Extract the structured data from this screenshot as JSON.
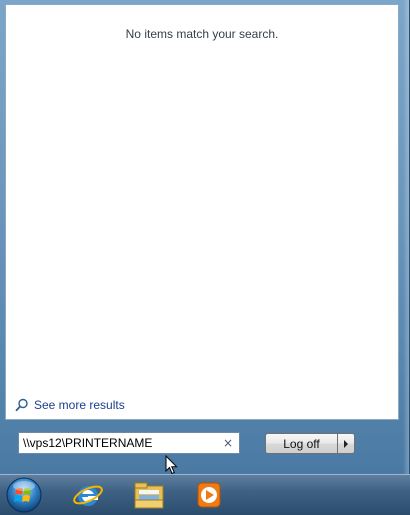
{
  "results": {
    "empty_message": "No items match your search."
  },
  "see_more": {
    "label": "See more results",
    "icon": "magnifier-icon"
  },
  "search": {
    "value": "\\\\vps12\\PRINTERNAME",
    "clear_icon": "×"
  },
  "power": {
    "logoff_label": "Log off",
    "arrow_icon": "triangle-right-icon"
  },
  "taskbar": {
    "icons": [
      "windows-start-orb",
      "internet-explorer-icon",
      "windows-explorer-icon",
      "media-player-icon"
    ]
  },
  "colors": {
    "link": "#1a3f8f",
    "menu_frame": "#6b96bb",
    "taskbar": "#3f6284"
  }
}
